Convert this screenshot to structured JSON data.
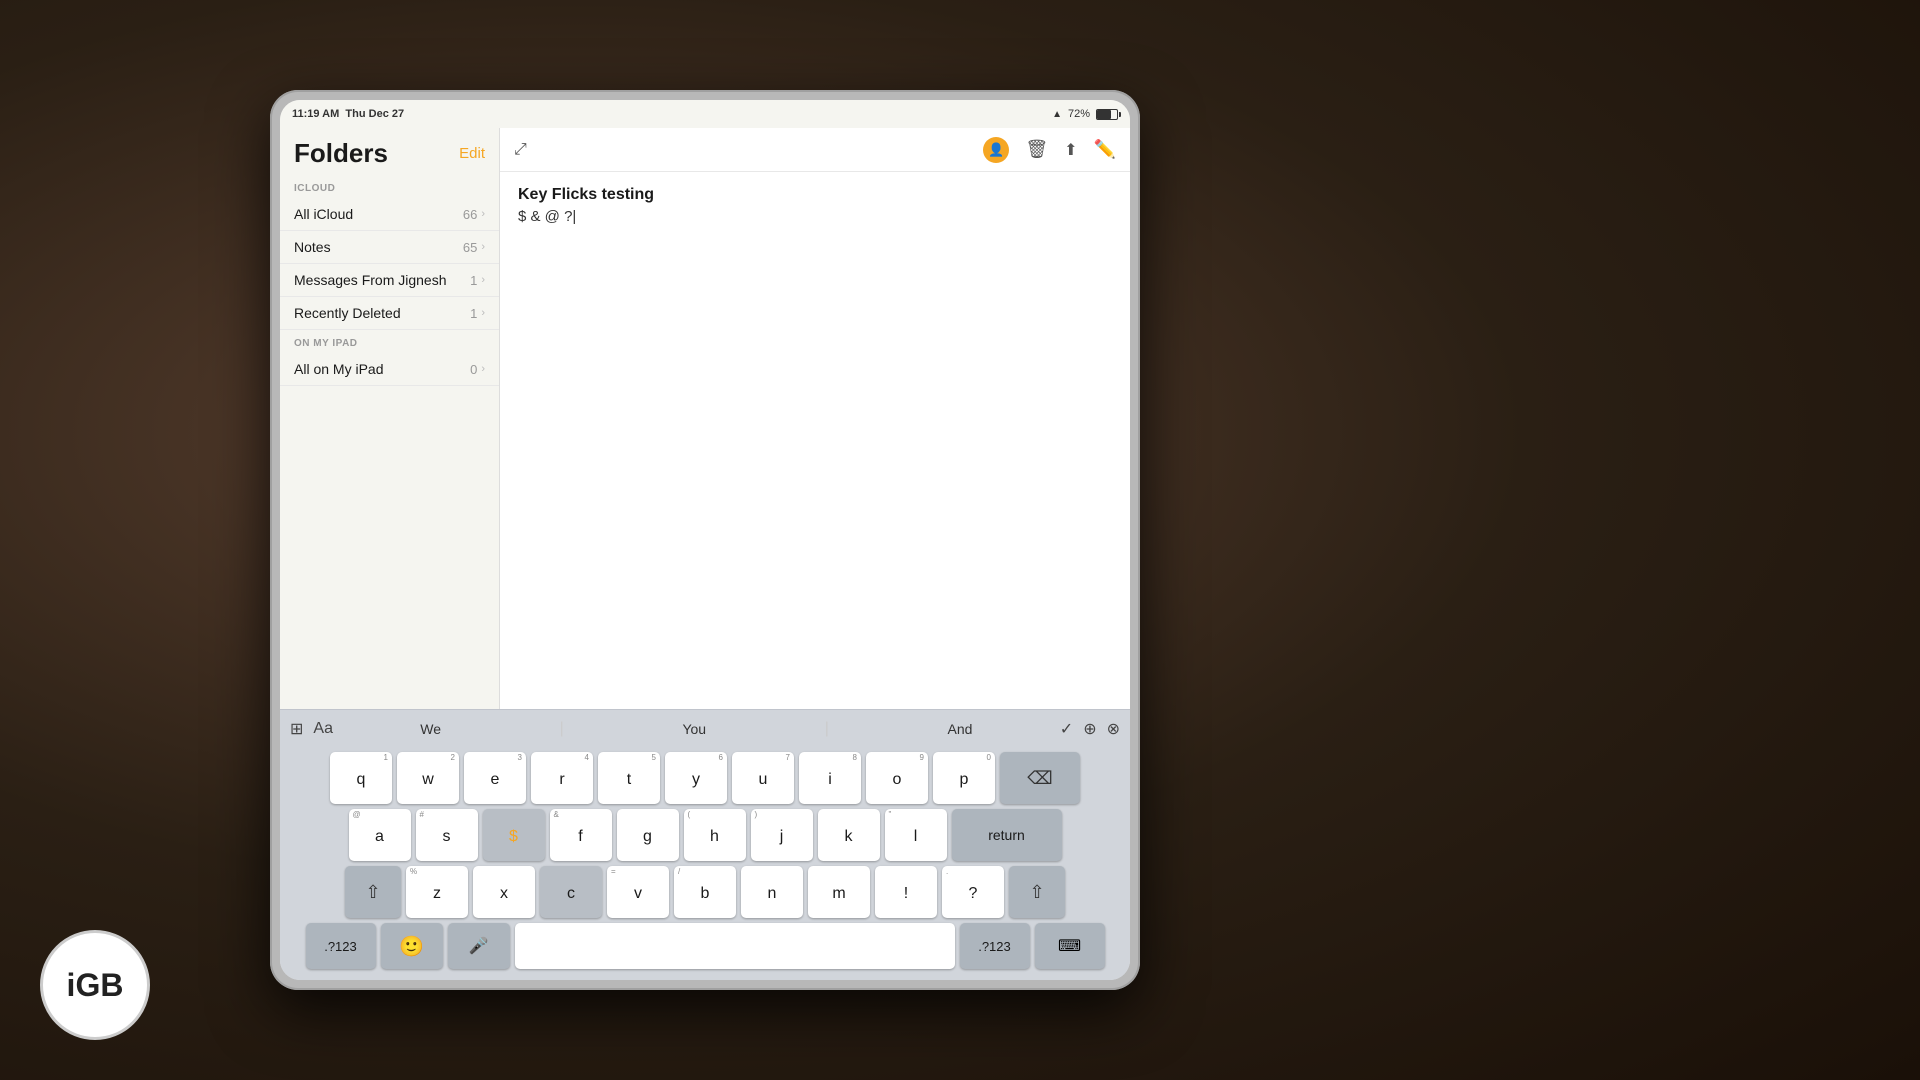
{
  "background": {
    "description": "dark blurred background with person holding iPad"
  },
  "logo": {
    "text": "iGB"
  },
  "status_bar": {
    "time": "11:19 AM",
    "date": "Thu Dec 27",
    "battery_percent": "72%",
    "wifi": "WiFi"
  },
  "folders_panel": {
    "title": "Folders",
    "edit_label": "Edit",
    "sections": [
      {
        "label": "ICLOUD",
        "items": [
          {
            "name": "All iCloud",
            "count": "66"
          },
          {
            "name": "Notes",
            "count": "65"
          },
          {
            "name": "Messages From Jignesh",
            "count": "1"
          },
          {
            "name": "Recently Deleted",
            "count": "1"
          }
        ]
      },
      {
        "label": "ON MY IPAD",
        "items": [
          {
            "name": "All on My iPad",
            "count": "0"
          }
        ]
      }
    ]
  },
  "note": {
    "title": "Key Flicks testing",
    "body": "$ & @ ?|"
  },
  "predictive": {
    "words": [
      "We",
      "You",
      "And"
    ]
  },
  "keyboard": {
    "rows": [
      {
        "keys": [
          {
            "letter": "q",
            "number": "1",
            "symbol": ""
          },
          {
            "letter": "w",
            "number": "2",
            "symbol": ""
          },
          {
            "letter": "e",
            "number": "3",
            "symbol": ""
          },
          {
            "letter": "r",
            "number": "4",
            "symbol": ""
          },
          {
            "letter": "t",
            "number": "5",
            "symbol": ""
          },
          {
            "letter": "y",
            "number": "6",
            "symbol": ""
          },
          {
            "letter": "u",
            "number": "7",
            "symbol": ""
          },
          {
            "letter": "i",
            "number": "8",
            "symbol": ""
          },
          {
            "letter": "o",
            "number": "9",
            "symbol": ""
          },
          {
            "letter": "p",
            "number": "0",
            "symbol": ""
          }
        ]
      },
      {
        "keys": [
          {
            "letter": "a",
            "number": "",
            "symbol": "@"
          },
          {
            "letter": "s",
            "number": "",
            "symbol": "#"
          },
          {
            "letter": "$",
            "number": "",
            "symbol": "",
            "active": true
          },
          {
            "letter": "f",
            "number": "",
            "symbol": "&"
          },
          {
            "letter": "g",
            "number": "",
            "symbol": ""
          },
          {
            "letter": "h",
            "number": "",
            "symbol": "("
          },
          {
            "letter": "j",
            "number": "",
            "symbol": ")"
          },
          {
            "letter": "k",
            "number": "",
            "symbol": ""
          },
          {
            "letter": "l",
            "number": "",
            "symbol": "\""
          }
        ]
      },
      {
        "keys": [
          {
            "letter": "z",
            "number": "",
            "symbol": "%"
          },
          {
            "letter": "x",
            "number": "",
            "symbol": ""
          },
          {
            "letter": "c",
            "number": "",
            "symbol": "",
            "active": true,
            "finger": true
          },
          {
            "letter": "v",
            "number": "",
            "symbol": "="
          },
          {
            "letter": "b",
            "number": "",
            "symbol": "/"
          },
          {
            "letter": "n",
            "number": "",
            "symbol": ""
          },
          {
            "letter": "m",
            "number": "",
            "symbol": "!"
          },
          {
            "letter": "!",
            "number": "",
            "symbol": ""
          },
          {
            "letter": "?",
            "number": "",
            "symbol": "."
          }
        ]
      }
    ],
    "bottom_row": {
      "numbers_label": ".?123",
      "emoji": "🙂",
      "mic": "🎤",
      "space_label": "",
      "numbers2_label": ".?123",
      "hide_label": "⌨"
    },
    "special_keys": {
      "return": "return",
      "delete": "⌫",
      "shift": "⇧"
    }
  }
}
